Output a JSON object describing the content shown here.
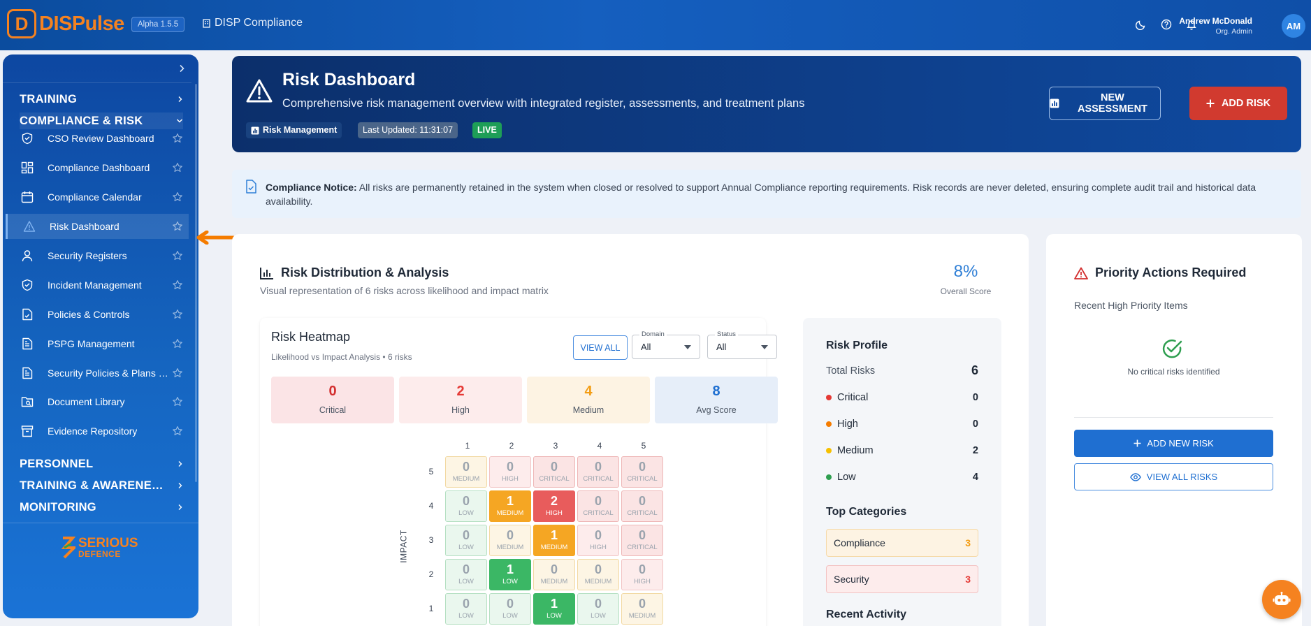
{
  "topbar": {
    "logo_letter": "D",
    "logo_text": "DISPulse",
    "version": "Alpha 1.5.5",
    "app_name": "DISP Compliance",
    "user_name": "Andrew McDonald",
    "user_role": "Org. Admin",
    "avatar_initials": "AM",
    "icons": [
      "moon-icon",
      "help-icon",
      "bell-icon"
    ]
  },
  "sidebar": {
    "sections": {
      "training": "TRAINING",
      "compliance": "COMPLIANCE & RISK",
      "personnel": "PERSONNEL",
      "training_awareness": "TRAINING & AWARENESS",
      "monitoring": "MONITORING"
    },
    "items": [
      {
        "label": "CSO Review Dashboard",
        "icon": "shield-check-icon"
      },
      {
        "label": "Compliance Dashboard",
        "icon": "dashboard-grid-icon"
      },
      {
        "label": "Compliance Calendar",
        "icon": "calendar-icon"
      },
      {
        "label": "Risk Dashboard",
        "icon": "warning-triangle-icon"
      },
      {
        "label": "Security Registers",
        "icon": "user-icon"
      },
      {
        "label": "Incident Management",
        "icon": "shield-check-icon"
      },
      {
        "label": "Policies & Controls",
        "icon": "document-check-icon"
      },
      {
        "label": "PSPG Management",
        "icon": "document-icon"
      },
      {
        "label": "Security Policies & Plans Management",
        "icon": "document-icon"
      },
      {
        "label": "Document Library",
        "icon": "folder-search-icon"
      },
      {
        "label": "Evidence Repository",
        "icon": "archive-icon"
      }
    ],
    "brand_line1": "SERIOUS",
    "brand_line2": "DEFENCE"
  },
  "hero": {
    "title": "Risk Dashboard",
    "subtitle": "Comprehensive risk management overview with integrated register, assessments, and treatment plans",
    "chip_module": "Risk Management",
    "chip_updated": "Last Updated: 11:31:07",
    "chip_live": "LIVE",
    "btn_new_assessment": "NEW ASSESSMENT",
    "btn_add_risk": "ADD RISK"
  },
  "notice": {
    "label": "Compliance Notice:",
    "text": " All risks are permanently retained in the system when closed or resolved to support Annual Compliance reporting requirements. Risk records are never deleted, ensuring complete audit trail and historical data availability."
  },
  "distribution": {
    "title": "Risk Distribution & Analysis",
    "subtitle": "Visual representation of 6 risks across likelihood and impact matrix",
    "score_value": "8%",
    "score_label": "Overall Score"
  },
  "heatmap": {
    "title": "Risk Heatmap",
    "subtitle": "Likelihood vs Impact Analysis • 6 risks",
    "view_all": "VIEW ALL",
    "domain_label": "Domain",
    "domain_value": "All",
    "status_label": "Status",
    "status_value": "All",
    "stats": [
      {
        "value": "0",
        "label": "Critical",
        "color": "#d32f2f",
        "bg": "#fbe4e6"
      },
      {
        "value": "2",
        "label": "High",
        "color": "#e53935",
        "bg": "#fdecec"
      },
      {
        "value": "4",
        "label": "Medium",
        "color": "#f39c12",
        "bg": "#fdf3e3"
      },
      {
        "value": "8",
        "label": "Avg Score",
        "color": "#1f6fd1",
        "bg": "#e6eef9"
      }
    ],
    "likelihood_axis": [
      "1",
      "2",
      "3",
      "4",
      "5"
    ],
    "impact_axis": [
      "5",
      "4",
      "3",
      "2",
      "1"
    ],
    "impact_label": "IMPACT",
    "grid": [
      [
        {
          "v": "0",
          "l": "MEDIUM"
        },
        {
          "v": "0",
          "l": "HIGH"
        },
        {
          "v": "0",
          "l": "CRITICAL"
        },
        {
          "v": "0",
          "l": "CRITICAL"
        },
        {
          "v": "0",
          "l": "CRITICAL"
        }
      ],
      [
        {
          "v": "0",
          "l": "LOW"
        },
        {
          "v": "1",
          "l": "MEDIUM"
        },
        {
          "v": "2",
          "l": "HIGH"
        },
        {
          "v": "0",
          "l": "CRITICAL"
        },
        {
          "v": "0",
          "l": "CRITICAL"
        }
      ],
      [
        {
          "v": "0",
          "l": "LOW"
        },
        {
          "v": "0",
          "l": "MEDIUM"
        },
        {
          "v": "1",
          "l": "MEDIUM"
        },
        {
          "v": "0",
          "l": "HIGH"
        },
        {
          "v": "0",
          "l": "CRITICAL"
        }
      ],
      [
        {
          "v": "0",
          "l": "LOW"
        },
        {
          "v": "1",
          "l": "LOW"
        },
        {
          "v": "0",
          "l": "MEDIUM"
        },
        {
          "v": "0",
          "l": "MEDIUM"
        },
        {
          "v": "0",
          "l": "HIGH"
        }
      ],
      [
        {
          "v": "0",
          "l": "LOW"
        },
        {
          "v": "0",
          "l": "LOW"
        },
        {
          "v": "1",
          "l": "LOW"
        },
        {
          "v": "0",
          "l": "LOW"
        },
        {
          "v": "0",
          "l": "MEDIUM"
        }
      ]
    ]
  },
  "profile": {
    "title": "Risk Profile",
    "total_label": "Total Risks",
    "total_value": "6",
    "levels": [
      {
        "label": "Critical",
        "value": "0",
        "color": "#e53935"
      },
      {
        "label": "High",
        "value": "0",
        "color": "#f57c00"
      },
      {
        "label": "Medium",
        "value": "2",
        "color": "#f6c000"
      },
      {
        "label": "Low",
        "value": "4",
        "color": "#2e9e4f"
      }
    ],
    "categories_title": "Top Categories",
    "categories": [
      {
        "label": "Compliance",
        "value": "3",
        "color": "#f39c12",
        "bg": "#fdf3e3",
        "border": "#f5d9a8"
      },
      {
        "label": "Security",
        "value": "3",
        "color": "#e53935",
        "bg": "#fdecec",
        "border": "#f3c2c2"
      }
    ],
    "recent_title": "Recent Activity"
  },
  "priority": {
    "title": "Priority Actions Required",
    "subtitle": "Recent High Priority Items",
    "empty_text": "No critical risks identified",
    "btn_add_new": "ADD NEW RISK",
    "btn_view_all": "VIEW ALL RISKS"
  }
}
